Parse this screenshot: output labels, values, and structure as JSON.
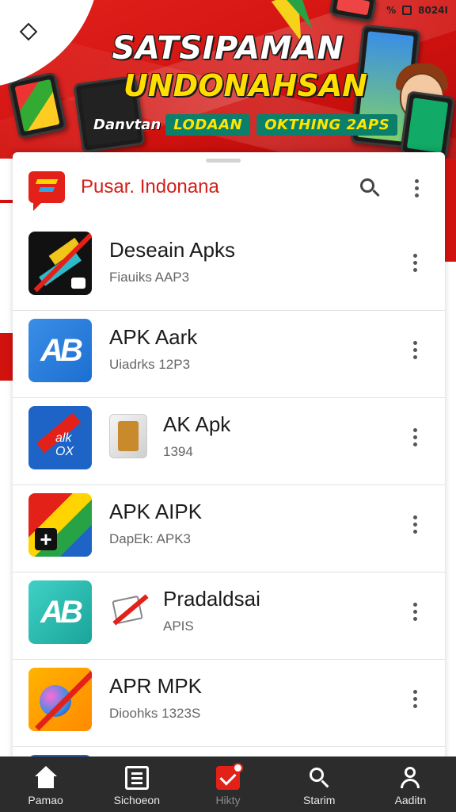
{
  "status_bar": {
    "time": "8024I",
    "percent": "%"
  },
  "banner": {
    "headline_1": "SATSIPAMAN",
    "headline_2": "UNDONAHSAN",
    "tagline_lead": "Danvtan",
    "tagline_chip_1": "LODAAN",
    "tagline_chip_2": "OKTHING 2APS",
    "colors": {
      "red": "#e2211c",
      "yellow": "#ffde00",
      "teal": "#0b7f6a"
    }
  },
  "header": {
    "title": "Pusar. Indonana",
    "search_icon": "search-icon",
    "menu_icon": "more-vert-icon"
  },
  "apps": [
    {
      "title": "Deseain Apks",
      "subtitle": "Fiauiks  AAP3"
    },
    {
      "title": "APK  Aark",
      "subtitle": "Uiadrks  12P3"
    },
    {
      "title": "AK Apk",
      "subtitle": "1394"
    },
    {
      "title": "APK  AIPK",
      "subtitle": "DapEk:  APK3"
    },
    {
      "title": "Pradaldsai",
      "subtitle": "APIS"
    },
    {
      "title": "APR  MPK",
      "subtitle": "Dioohks  1323S"
    }
  ],
  "icon_text": {
    "app_2": "AB",
    "app_3": "alk OX",
    "app_5": "AB"
  },
  "bottom_nav": [
    {
      "label": "Pamao",
      "icon": "home-icon"
    },
    {
      "label": "Sichoeon",
      "icon": "list-icon"
    },
    {
      "label": "Hikty",
      "icon": "category-icon"
    },
    {
      "label": "Starim",
      "icon": "search-icon"
    },
    {
      "label": "Aaditn",
      "icon": "account-icon"
    }
  ]
}
